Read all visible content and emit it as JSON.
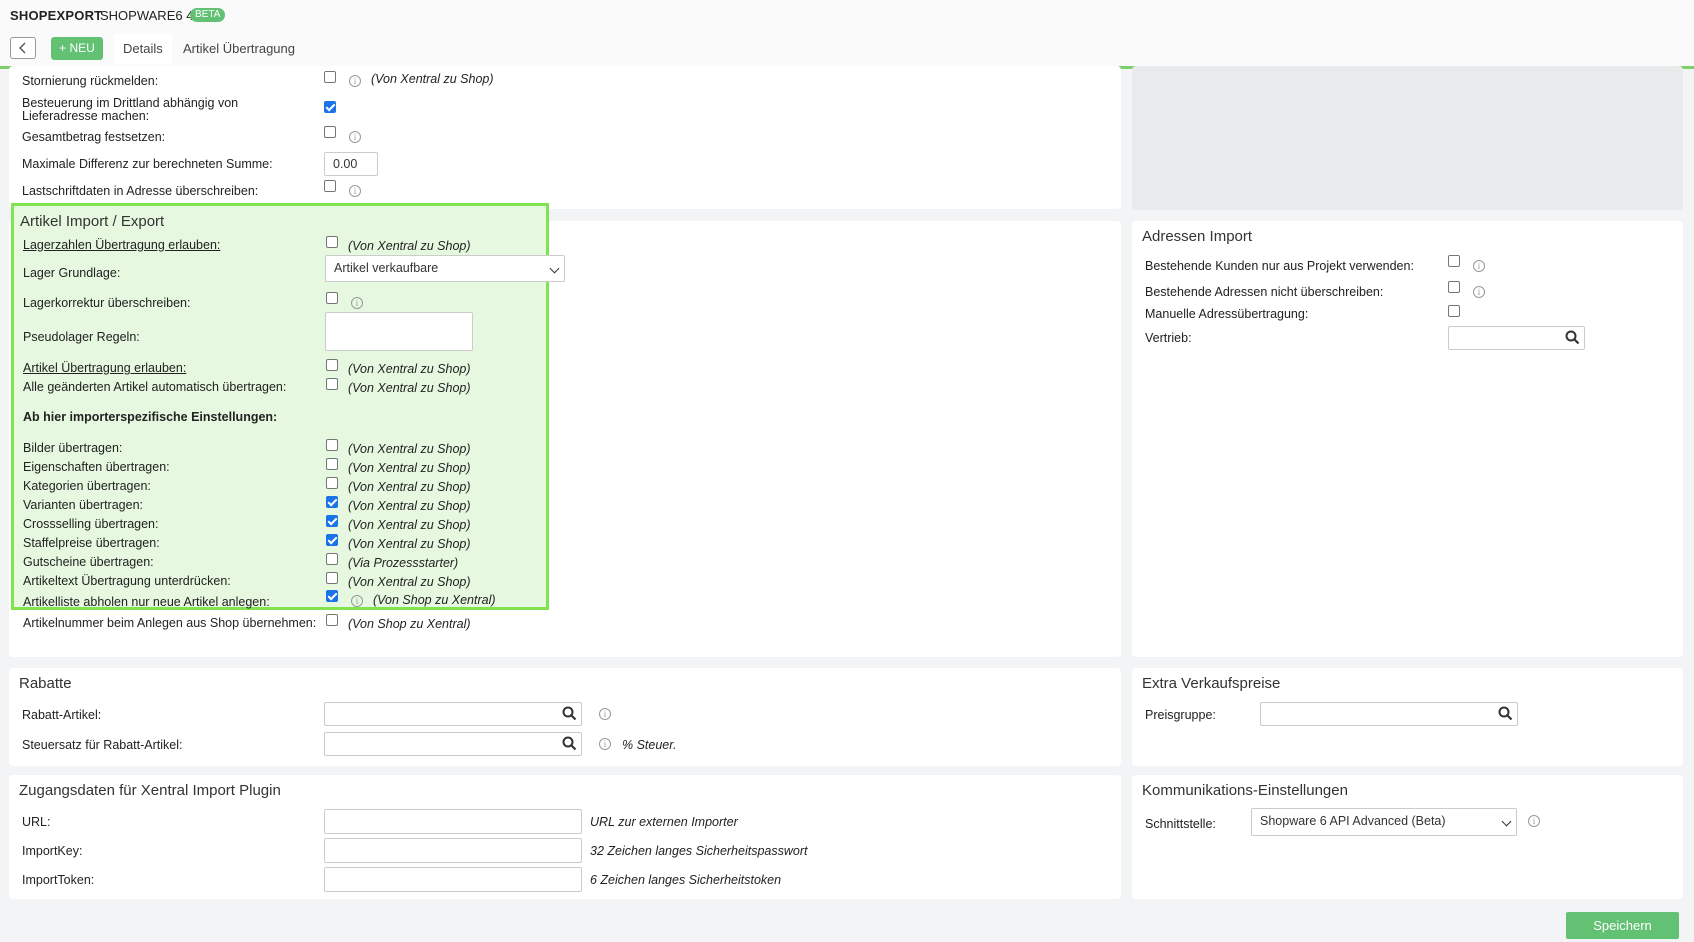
{
  "header": {
    "app": "SHOPEXPORT",
    "module": "SHOPWARE6 4",
    "badge": "BETA"
  },
  "toolbar": {
    "new_label": "+ NEU",
    "tabs": [
      "Details",
      "Artikel Übertragung"
    ]
  },
  "orders": {
    "rows": [
      {
        "label": "Stornierung rückmelden:",
        "checked": false,
        "note": "(Von Xentral zu Shop)"
      },
      {
        "label_line1": "Besteuerung im Drittland abhängig von",
        "label_line2": "Lieferadresse machen:",
        "checked": true
      },
      {
        "label": "Gesamtbetrag festsetzen:",
        "checked": false
      },
      {
        "label": "Maximale Differenz zur berechneten Summe:",
        "value": "0.00"
      },
      {
        "label": "Lastschriftdaten in Adresse überschreiben:",
        "checked": false
      }
    ]
  },
  "article": {
    "title": "Artikel Import / Export",
    "stock_label": "Lagerzahlen Übertragung erlauben:",
    "stock_note": "(Von Xentral zu Shop)",
    "warehouse_label": "Lager Grundlage:",
    "warehouse_value": "Artikel verkaufbare",
    "stockcorr_label": "Lagerkorrektur überschreiben:",
    "pseudo_label": "Pseudolager Regeln:",
    "transfer_label": "Artikel Übertragung erlauben:",
    "transfer_note": "(Von Xentral zu Shop)",
    "auto_label": "Alle geänderten Artikel automatisch übertragen:",
    "auto_note": "(Von Xentral zu Shop)",
    "importer_heading": "Ab hier importerspezifische Einstellungen:",
    "options": [
      {
        "label": "Bilder übertragen:",
        "checked": false,
        "note": "(Von Xentral zu Shop)"
      },
      {
        "label": "Eigenschaften übertragen:",
        "checked": false,
        "note": "(Von Xentral zu Shop)"
      },
      {
        "label": "Kategorien übertragen:",
        "checked": false,
        "note": "(Von Xentral zu Shop)"
      },
      {
        "label": "Varianten übertragen:",
        "checked": true,
        "note": "(Von Xentral zu Shop)"
      },
      {
        "label": "Crossselling übertragen:",
        "checked": true,
        "note": "(Von Xentral zu Shop)"
      },
      {
        "label": "Staffelpreise übertragen:",
        "checked": true,
        "note": "(Von Xentral zu Shop)"
      },
      {
        "label": "Gutscheine übertragen:",
        "checked": false,
        "note": "(Via Prozessstarter)"
      },
      {
        "label": "Artikeltext Übertragung unterdrücken:",
        "checked": false,
        "note": "(Von Xentral zu Shop)"
      },
      {
        "label": "Artikelliste abholen nur neue Artikel anlegen:",
        "checked": true,
        "note": "(Von Shop zu Xentral)"
      },
      {
        "label": "Artikelnummer beim Anlegen aus Shop übernehmen:",
        "checked": false,
        "note": "(Von Shop zu Xentral)"
      }
    ]
  },
  "address": {
    "title": "Adressen Import",
    "rows": [
      {
        "label": "Bestehende Kunden nur aus Projekt verwenden:",
        "checked": false
      },
      {
        "label": "Bestehende Adressen nicht überschreiben:",
        "checked": false
      },
      {
        "label": "Manuelle Adressübertragung:",
        "checked": false
      }
    ],
    "sales_label": "Vertrieb:"
  },
  "discounts": {
    "title": "Rabatte",
    "item_label": "Rabatt-Artikel:",
    "tax_label": "Steuersatz für Rabatt-Artikel:",
    "tax_note": "% Steuer."
  },
  "extra_prices": {
    "title": "Extra Verkaufspreise",
    "group_label": "Preisgruppe:"
  },
  "access": {
    "title": "Zugangsdaten für Xentral Import Plugin",
    "url_label": "URL:",
    "url_note": "URL zur externen Importer",
    "key_label": "ImportKey:",
    "key_note": "32 Zeichen langes Sicherheitspasswort",
    "token_label": "ImportToken:",
    "token_note": "6 Zeichen langes Sicherheitstoken"
  },
  "comm": {
    "title": "Kommunikations-Einstellungen",
    "iface_label": "Schnittstelle:",
    "iface_value": "Shopware 6 API Advanced (Beta)"
  },
  "footer": {
    "save_label": "Speichern"
  },
  "colors": {
    "accent_green": "#63c174",
    "highlight_border": "#7fe44f",
    "highlight_bg": "#e6f8e0",
    "checkbox_blue": "#1a73e8"
  }
}
